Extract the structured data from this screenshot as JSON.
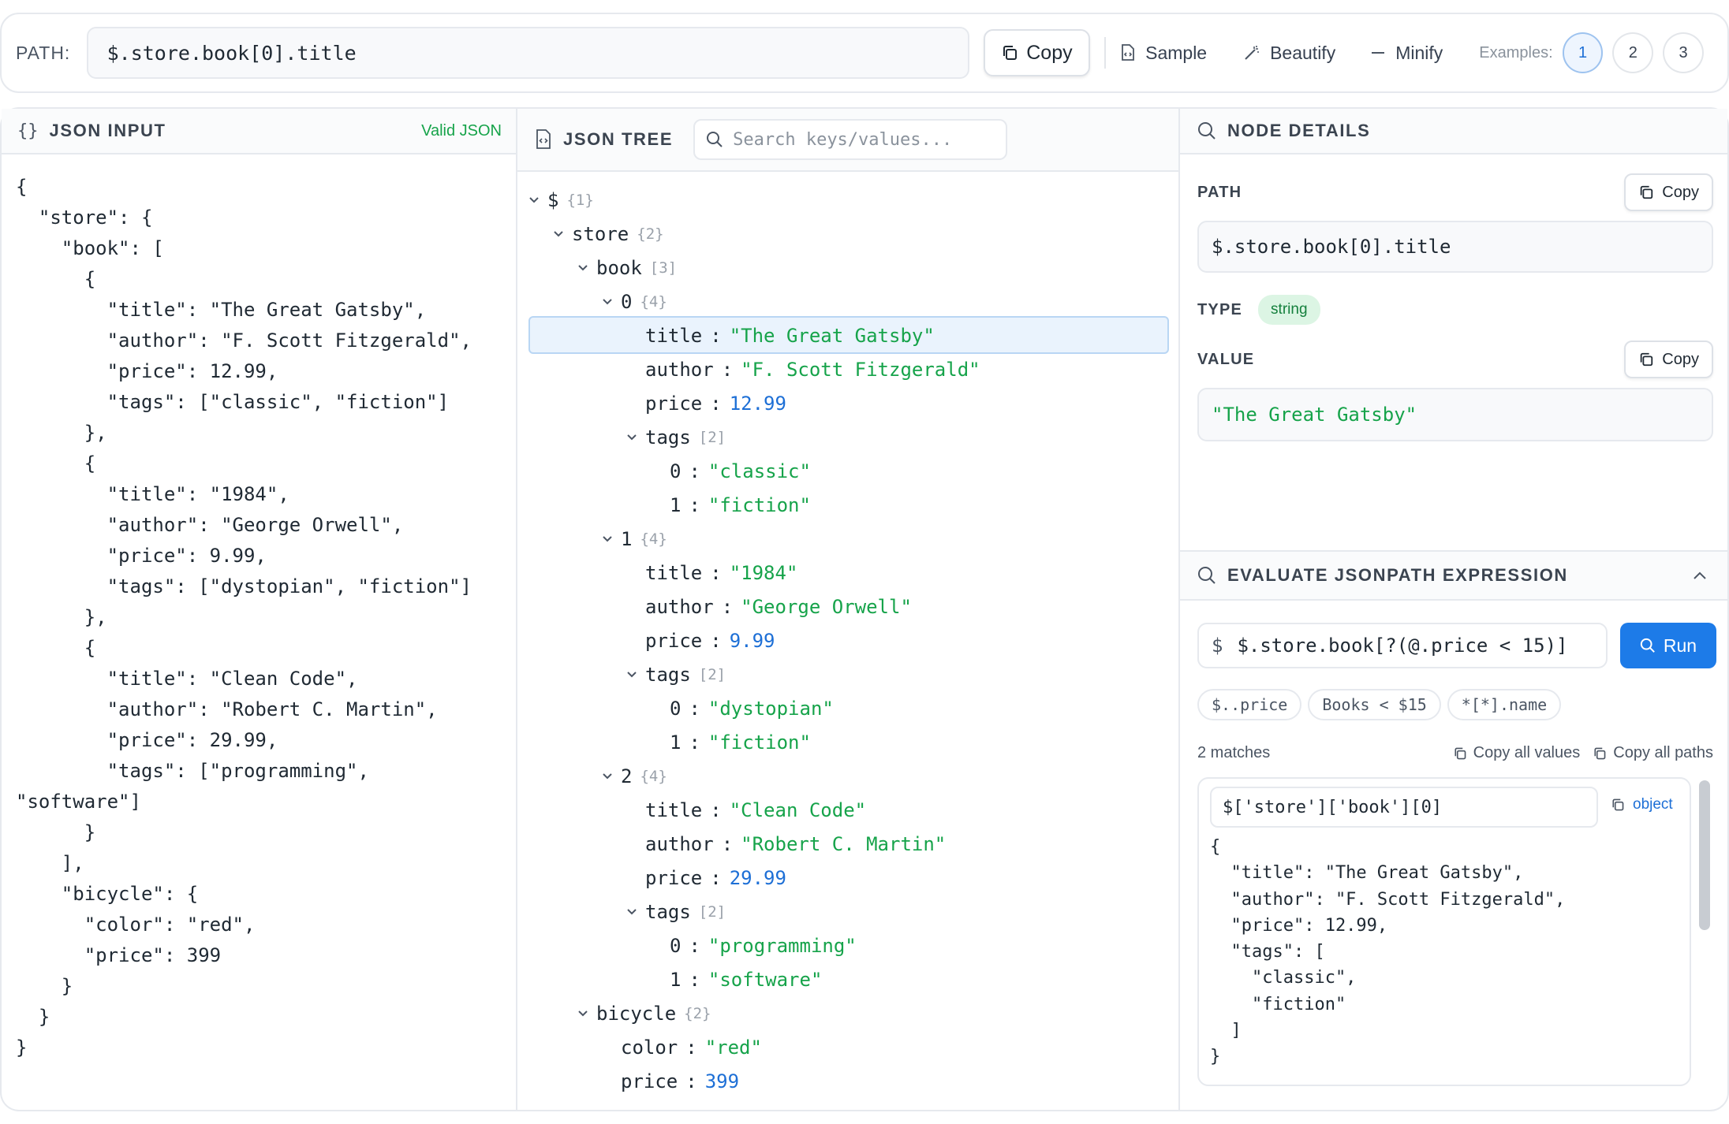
{
  "topbar": {
    "path_label": "PATH:",
    "path_value": "$.store.book[0].title",
    "copy_label": "Copy",
    "sample_label": "Sample",
    "beautify_label": "Beautify",
    "minify_label": "Minify",
    "examples_label": "Examples:",
    "examples": [
      "1",
      "2",
      "3"
    ],
    "active_example": "1"
  },
  "input_panel": {
    "title": "JSON INPUT",
    "status": "Valid JSON",
    "text": "{\n  \"store\": {\n    \"book\": [\n      {\n        \"title\": \"The Great Gatsby\",\n        \"author\": \"F. Scott Fitzgerald\",\n        \"price\": 12.99,\n        \"tags\": [\"classic\", \"fiction\"]\n      },\n      {\n        \"title\": \"1984\",\n        \"author\": \"George Orwell\",\n        \"price\": 9.99,\n        \"tags\": [\"dystopian\", \"fiction\"]\n      },\n      {\n        \"title\": \"Clean Code\",\n        \"author\": \"Robert C. Martin\",\n        \"price\": 29.99,\n        \"tags\": [\"programming\",\n\"software\"]\n      }\n    ],\n    \"bicycle\": {\n      \"color\": \"red\",\n      \"price\": 399\n    }\n  }\n}"
  },
  "tree_panel": {
    "title": "JSON TREE",
    "search_placeholder": "Search keys/values...",
    "rows": [
      {
        "depth": 0,
        "toggle": true,
        "key": "$",
        "count": "{1}"
      },
      {
        "depth": 1,
        "toggle": true,
        "key": "store",
        "count": "{2}"
      },
      {
        "depth": 2,
        "toggle": true,
        "key": "book",
        "count": "[3]"
      },
      {
        "depth": 3,
        "toggle": true,
        "key": "0",
        "count": "{4}"
      },
      {
        "depth": 4,
        "key": "title",
        "value": "\"The Great Gatsby\"",
        "vtype": "str",
        "selected": true
      },
      {
        "depth": 4,
        "key": "author",
        "value": "\"F. Scott Fitzgerald\"",
        "vtype": "str"
      },
      {
        "depth": 4,
        "key": "price",
        "value": "12.99",
        "vtype": "num"
      },
      {
        "depth": 4,
        "toggle": true,
        "key": "tags",
        "count": "[2]"
      },
      {
        "depth": 5,
        "key": "0",
        "value": "\"classic\"",
        "vtype": "str"
      },
      {
        "depth": 5,
        "key": "1",
        "value": "\"fiction\"",
        "vtype": "str"
      },
      {
        "depth": 3,
        "toggle": true,
        "key": "1",
        "count": "{4}"
      },
      {
        "depth": 4,
        "key": "title",
        "value": "\"1984\"",
        "vtype": "str"
      },
      {
        "depth": 4,
        "key": "author",
        "value": "\"George Orwell\"",
        "vtype": "str"
      },
      {
        "depth": 4,
        "key": "price",
        "value": "9.99",
        "vtype": "num"
      },
      {
        "depth": 4,
        "toggle": true,
        "key": "tags",
        "count": "[2]"
      },
      {
        "depth": 5,
        "key": "0",
        "value": "\"dystopian\"",
        "vtype": "str"
      },
      {
        "depth": 5,
        "key": "1",
        "value": "\"fiction\"",
        "vtype": "str"
      },
      {
        "depth": 3,
        "toggle": true,
        "key": "2",
        "count": "{4}"
      },
      {
        "depth": 4,
        "key": "title",
        "value": "\"Clean Code\"",
        "vtype": "str"
      },
      {
        "depth": 4,
        "key": "author",
        "value": "\"Robert C. Martin\"",
        "vtype": "str"
      },
      {
        "depth": 4,
        "key": "price",
        "value": "29.99",
        "vtype": "num"
      },
      {
        "depth": 4,
        "toggle": true,
        "key": "tags",
        "count": "[2]"
      },
      {
        "depth": 5,
        "key": "0",
        "value": "\"programming\"",
        "vtype": "str"
      },
      {
        "depth": 5,
        "key": "1",
        "value": "\"software\"",
        "vtype": "str"
      },
      {
        "depth": 2,
        "toggle": true,
        "key": "bicycle",
        "count": "{2}"
      },
      {
        "depth": 3,
        "key": "color",
        "value": "\"red\"",
        "vtype": "str"
      },
      {
        "depth": 3,
        "key": "price",
        "value": "399",
        "vtype": "num"
      }
    ]
  },
  "details_panel": {
    "title": "NODE DETAILS",
    "path_label": "PATH",
    "path_value": "$.store.book[0].title",
    "copy_label": "Copy",
    "type_label": "TYPE",
    "type_value": "string",
    "value_label": "VALUE",
    "value": "\"The Great Gatsby\""
  },
  "evaluate": {
    "title": "EVALUATE JSONPATH EXPRESSION",
    "prefix": "$",
    "expression": "$.store.book[?(@.price < 15)]",
    "run_label": "Run",
    "presets": [
      "$..price",
      "Books < $15",
      "*[*].name"
    ],
    "match_count": "2 matches",
    "copy_values_label": "Copy all values",
    "copy_paths_label": "Copy all paths",
    "result_path": "$['store']['book'][0]",
    "result_type": "object",
    "result_json": "{\n  \"title\": \"The Great Gatsby\",\n  \"author\": \"F. Scott Fitzgerald\",\n  \"price\": 12.99,\n  \"tags\": [\n    \"classic\",\n    \"fiction\"\n  ]\n}"
  },
  "colors": {
    "accent": "#1d7be8",
    "string": "#16a34a",
    "number": "#1d6fd6",
    "selection_bg": "#eaf3fd"
  }
}
